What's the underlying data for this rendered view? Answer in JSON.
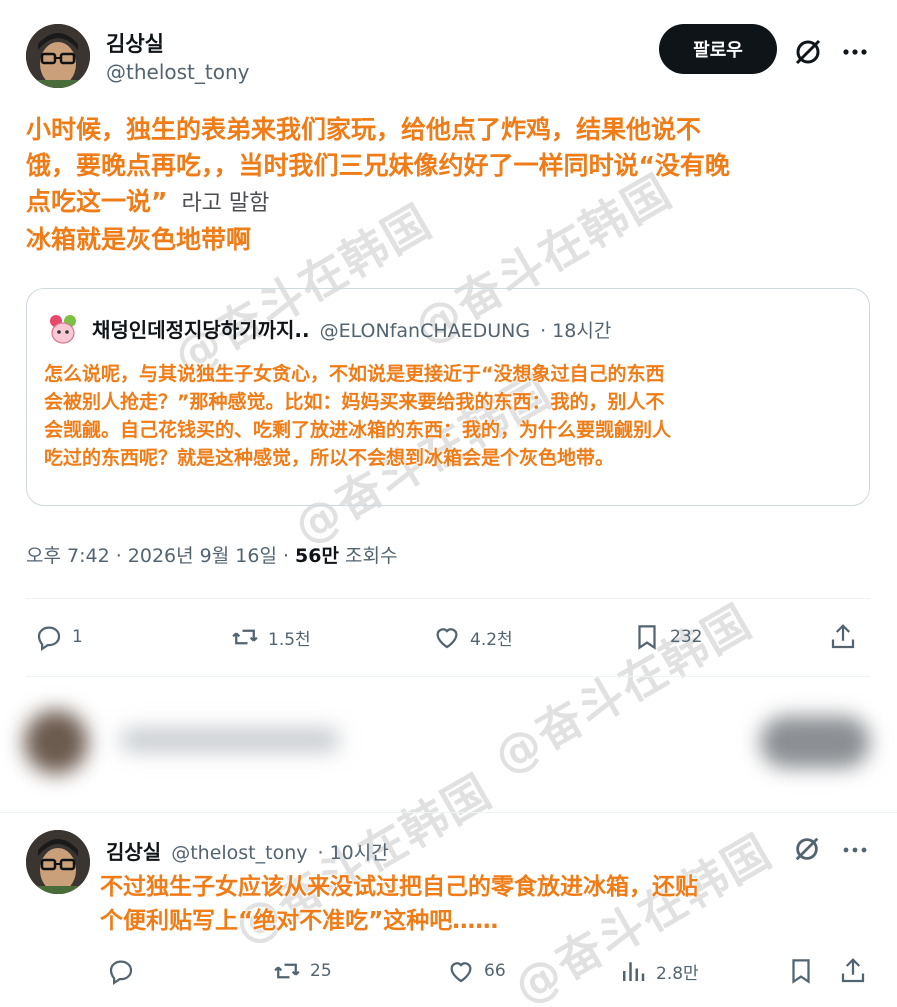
{
  "main_post": {
    "author_name": "김상실",
    "author_handle": "@thelost_tony",
    "follow_label": "팔로우",
    "overlay_lines": [
      "小时候，独生的表弟来我们家玩，给他点了炸鸡，结果他说不",
      "饿，要晚点再吃，，当时我们三兄妹像约好了一样同时说“没有晚",
      "点吃这一说”",
      "冰箱就是灰色地带啊"
    ],
    "korean_fragment": "라고 말함",
    "timestamp": "오후 7:42 · 2026년 9월 16일 · ",
    "views_count": "56만",
    "views_label": "조회수"
  },
  "quote": {
    "author_name": "채덩인데정지당하기까지..",
    "author_handle": "@ELONfanCHAEDUNG",
    "time": "· 18시간",
    "overlay_lines": [
      "怎么说呢，与其说独生子女贪心，不如说是更接近于“没想象过自己的东西",
      "会被别人抢走？”那种感觉。比如：妈妈买来要给我的东西：我的，别人不",
      "会觊觎。自己花钱买的、吃剩了放进冰箱的东西：我的，为什么要觊觎别人",
      "吃过的东西呢？就是这种感觉，所以不会想到冰箱会是个灰色地带。"
    ]
  },
  "main_actions": {
    "replies": "1",
    "reposts": "1.5천",
    "likes": "4.2천",
    "bookmarks": "232"
  },
  "reply": {
    "author_name": "김상실",
    "author_handle": "@thelost_tony",
    "time": "· 10시간",
    "overlay_lines": [
      "不过独生子女应该从来没试过把自己的零食放进冰箱，还贴",
      "个便利贴写上“绝对不准吃”这种吧……"
    ],
    "actions": {
      "reposts": "25",
      "likes": "66",
      "views": "2.8만"
    }
  },
  "watermark_text": "@奋斗在韩国",
  "colors": {
    "overlay": "#f07c18",
    "secondary_text": "#536471",
    "follow_bg": "#0f1419"
  }
}
